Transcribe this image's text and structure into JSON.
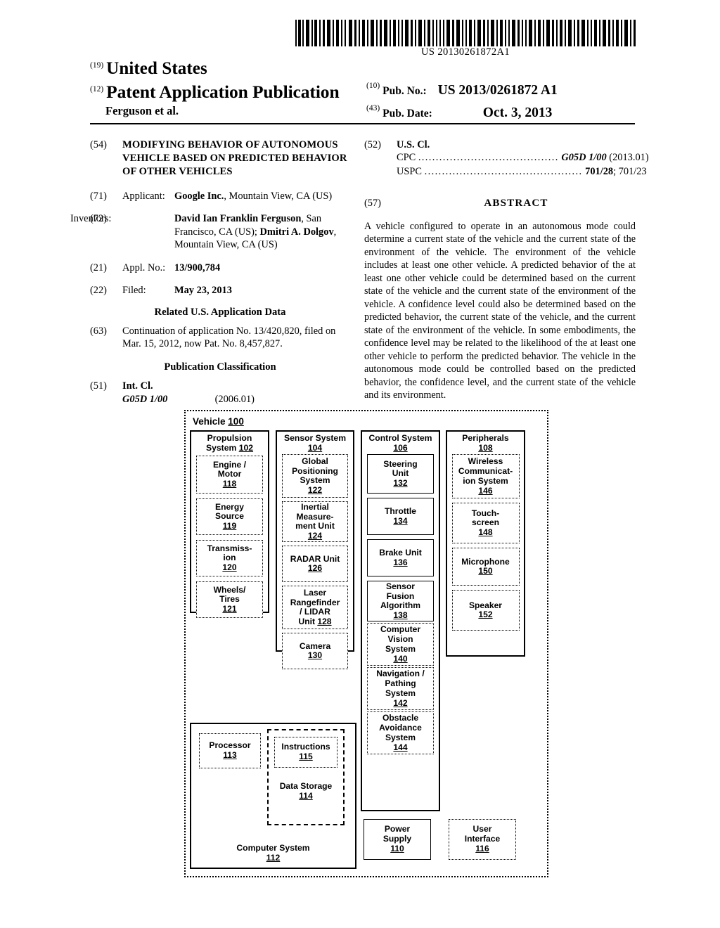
{
  "document": {
    "barcode_number": "US 20130261872A1",
    "kind": "patent-application-publication"
  },
  "masthead": {
    "code_19": "(19)",
    "country": "United States",
    "code_12": "(12)",
    "doc_type": "Patent Application Publication",
    "inventor_line": "Ferguson et al.",
    "code_10": "(10)",
    "pub_no_label": "Pub. No.:",
    "pub_no_value": "US 2013/0261872 A1",
    "code_43": "(43)",
    "pub_date_label": "Pub. Date:",
    "pub_date_value": "Oct. 3, 2013"
  },
  "left_column": {
    "title": {
      "code": "(54)",
      "text": "MODIFYING BEHAVIOR OF AUTONOMOUS VEHICLE BASED ON PREDICTED BEHAVIOR OF OTHER VEHICLES"
    },
    "applicant": {
      "code": "(71)",
      "label": "Applicant:",
      "name": "Google Inc.",
      "rest": ", Mountain View, CA (US)"
    },
    "inventors": {
      "code": "(72)",
      "label": "Inventors:",
      "name1": "David Ian Franklin Ferguson",
      "rest1": ", San Francisco, CA (US); ",
      "name2": "Dmitri A. Dolgov",
      "rest2": ", Mountain View, CA (US)"
    },
    "appl_no": {
      "code": "(21)",
      "label": "Appl. No.:",
      "value": "13/900,784"
    },
    "filed": {
      "code": "(22)",
      "label": "Filed:",
      "value": "May 23, 2013"
    },
    "related_heading": "Related U.S. Application Data",
    "related": {
      "code": "(63)",
      "text": "Continuation of application No. 13/420,820, filed on Mar. 15, 2012, now Pat. No. 8,457,827."
    },
    "pub_class_heading": "Publication Classification",
    "int_cl": {
      "code": "(51)",
      "label": "Int. Cl.",
      "symbol": "G05D 1/00",
      "edition": "(2006.01)"
    }
  },
  "right_column": {
    "us_cl": {
      "code": "(52)",
      "label": "U.S. Cl.",
      "cpc_label": "CPC",
      "cpc_dots": "........................................",
      "cpc_symbol": "G05D 1/00",
      "cpc_edition": "(2013.01)",
      "uspc_label": "USPC",
      "uspc_dots": ".............................................",
      "uspc_primary": "701/28",
      "uspc_rest": "; 701/23"
    },
    "abstract": {
      "code": "(57)",
      "heading": "ABSTRACT",
      "text": "A vehicle configured to operate in an autonomous mode could determine a current state of the vehicle and the current state of the environment of the vehicle. The environment of the vehicle includes at least one other vehicle. A predicted behavior of the at least one other vehicle could be determined based on the current state of the vehicle and the current state of the environment of the vehicle. A confidence level could also be determined based on the predicted behavior, the current state of the vehicle, and the current state of the environment of the vehicle. In some embodiments, the confidence level may be related to the likelihood of the at least one other vehicle to perform the predicted behavior. The vehicle in the autonomous mode could be controlled based on the predicted behavior, the confidence level, and the current state of the vehicle and its environment."
    }
  },
  "figure": {
    "outer_label_text": "Vehicle ",
    "outer_label_num": "100",
    "groups": [
      {
        "id": "propulsion-system",
        "title_line1": "Propulsion",
        "title_line2": "System ",
        "title_num": "102",
        "boxes": [
          {
            "lines": [
              "Engine /",
              "Motor"
            ],
            "num": "118"
          },
          {
            "lines": [
              "Energy",
              "Source"
            ],
            "num": "119"
          },
          {
            "lines": [
              "Transmiss-",
              "ion"
            ],
            "num": "120"
          },
          {
            "lines": [
              "Wheels/",
              "Tires"
            ],
            "num": "121"
          }
        ]
      },
      {
        "id": "sensor-system",
        "title_line1": "Sensor System",
        "title_line2": "",
        "title_num": "104",
        "boxes": [
          {
            "lines": [
              "Global",
              "Positioning",
              "System"
            ],
            "num": "122"
          },
          {
            "lines": [
              "Inertial",
              "Measure-",
              "ment Unit"
            ],
            "num": "124"
          },
          {
            "lines": [
              "RADAR Unit"
            ],
            "num": "126"
          },
          {
            "lines": [
              "Laser",
              "Rangefinder",
              "/ LIDAR",
              "Unit "
            ],
            "num": "128",
            "inline_num": true
          },
          {
            "lines": [
              "Camera"
            ],
            "num": "130"
          }
        ]
      },
      {
        "id": "control-system",
        "title_line1": "Control System",
        "title_line2": "",
        "title_num": "106",
        "boxes": [
          {
            "lines": [
              "Steering",
              "Unit"
            ],
            "num": "132"
          },
          {
            "lines": [
              "Throttle"
            ],
            "num": "134"
          },
          {
            "lines": [
              "Brake Unit"
            ],
            "num": "136"
          },
          {
            "lines": [
              "Sensor",
              "Fusion",
              "Algorithm"
            ],
            "num": "138"
          },
          {
            "lines": [
              "Computer",
              "Vision",
              "System"
            ],
            "num": "140"
          },
          {
            "lines": [
              "Navigation /",
              "Pathing",
              "System"
            ],
            "num": "142"
          },
          {
            "lines": [
              "Obstacle",
              "Avoidance",
              "System"
            ],
            "num": "144"
          }
        ]
      },
      {
        "id": "peripherals",
        "title_line1": "Peripherals",
        "title_line2": "",
        "title_num": "108",
        "boxes": [
          {
            "lines": [
              "Wireless",
              "Communicat-",
              "ion System"
            ],
            "num": "146"
          },
          {
            "lines": [
              "Touch-",
              "screen"
            ],
            "num": "148"
          },
          {
            "lines": [
              "Microphone"
            ],
            "num": "150"
          },
          {
            "lines": [
              "Speaker"
            ],
            "num": "152"
          }
        ]
      }
    ],
    "computer_system": {
      "title_line1": "Computer System",
      "title_num": "112",
      "processor": {
        "lines": [
          "Processor"
        ],
        "num": "113"
      },
      "data_storage": {
        "lines": [
          "Data Storage"
        ],
        "num": "114"
      },
      "instructions": {
        "lines": [
          "Instructions"
        ],
        "num": "115"
      }
    },
    "standalone": [
      {
        "id": "power-supply",
        "lines": [
          "Power",
          "Supply"
        ],
        "num": "110"
      },
      {
        "id": "user-interface",
        "lines": [
          "User",
          "Interface"
        ],
        "num": "116"
      }
    ]
  }
}
